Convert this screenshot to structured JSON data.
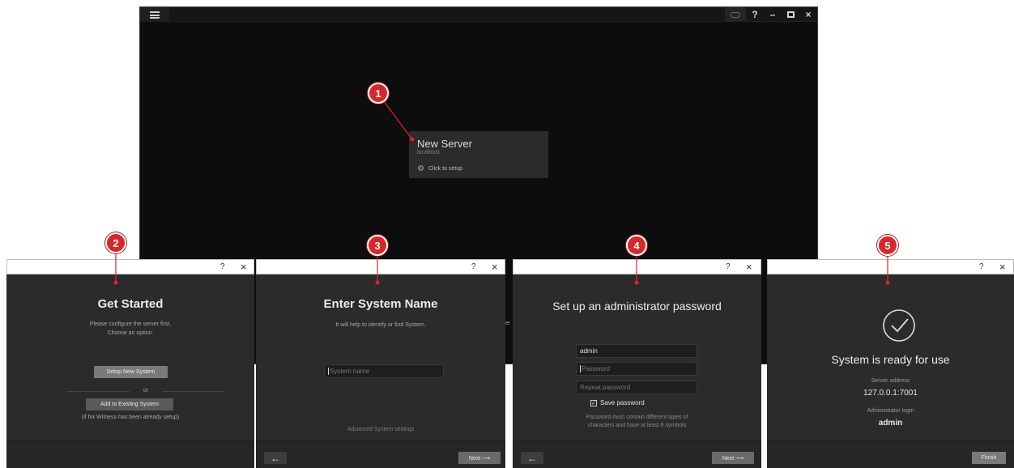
{
  "main_window": {
    "titlebar": {
      "help": "?",
      "minimize": "–",
      "close": "×"
    },
    "server_card": {
      "name": "New Server",
      "host": "localhost",
      "setup_label": "Click to setup"
    },
    "obscured_text": "er"
  },
  "markers": [
    "1",
    "2",
    "3",
    "4",
    "5"
  ],
  "dialogs": {
    "common": {
      "help": "?",
      "close": "×",
      "back_arrow": "←",
      "next_label": "Next ⟶"
    },
    "get_started": {
      "title": "Get Started",
      "subtitle_line1": "Please configure the server first.",
      "subtitle_line2": "Choose an option.",
      "setup_button": "Setup New System",
      "or_label": "or",
      "add_button": "Add to Existing System",
      "add_note": "(if Nx Witness has been already setup)"
    },
    "system_name": {
      "title": "Enter System Name",
      "subtitle": "It will help to identify or find System.",
      "input_placeholder": "System name",
      "advanced_link": "Advanced System settings"
    },
    "admin_password": {
      "title": "Set up an administrator password",
      "login_value": "admin",
      "password_placeholder": "Password",
      "repeat_placeholder": "Repeat password",
      "save_label": "Save password",
      "hint_line1": "Password must contain different types of",
      "hint_line2": "characters and have at least 8 symbols"
    },
    "ready": {
      "title": "System is ready for use",
      "address_label": "Server address",
      "address_value": "127.0.0.1:7001",
      "login_label": "Administrator login",
      "login_value": "admin",
      "finish_button": "Finish"
    }
  },
  "colors": {
    "marker": "#d9262a",
    "dialog_bg": "#2b2b2b",
    "window_bg": "#0d0d0d"
  },
  "icons": [
    "hamburger-icon",
    "cloud-icon",
    "maximize-icon",
    "gear-icon",
    "checkbox-icon",
    "check-circle-icon",
    "arrow-left-icon"
  ]
}
